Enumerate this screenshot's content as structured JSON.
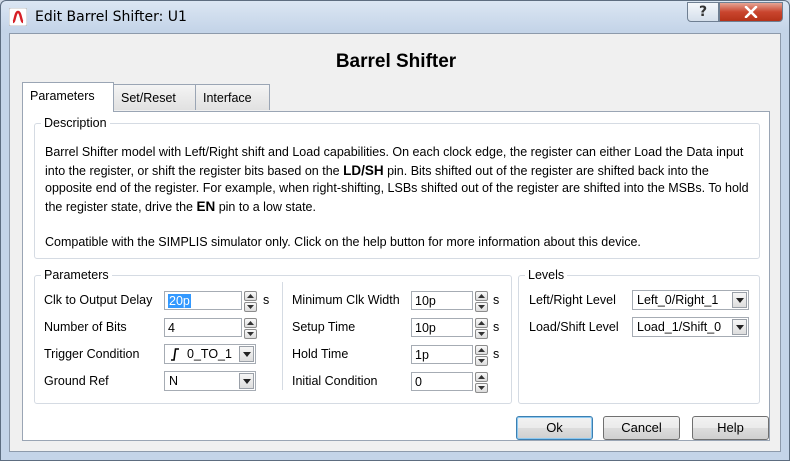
{
  "window": {
    "title": "Edit Barrel Shifter: U1",
    "help_glyph": "?",
    "close_glyph": "✕"
  },
  "heading": "Barrel Shifter",
  "tabs": [
    {
      "label": "Parameters",
      "active": true
    },
    {
      "label": "Set/Reset",
      "active": false
    },
    {
      "label": "Interface",
      "active": false
    }
  ],
  "description": {
    "legend": "Description",
    "p1_a": "Barrel Shifter model with Left/Right shift and Load capabilities. On each clock edge, the register can either Load the Data input into the register, or shift the register bits based on the ",
    "p1_pin1": "LD/SH",
    "p1_b": " pin. Bits shifted out of the register are shifted back into the opposite end of the register. For example, when right-shifting, LSBs shifted out of the register are shifted into the MSBs. To hold the register state, drive the ",
    "p1_pin2": "EN",
    "p1_c": " pin to a low state.",
    "p2": "Compatible with the SIMPLIS simulator only. Click on the help button for more information about this device."
  },
  "parameters": {
    "legend": "Parameters",
    "left": [
      {
        "label": "Clk to Output Delay",
        "value": "20p",
        "unit": "s"
      },
      {
        "label": "Number of Bits",
        "value": "4",
        "unit": ""
      },
      {
        "label": "Trigger Condition",
        "value": "0_TO_1",
        "icon": "rising-edge-icon"
      },
      {
        "label": "Ground Ref",
        "value": "N"
      }
    ],
    "right": [
      {
        "label": "Minimum Clk Width",
        "value": "10p",
        "unit": "s"
      },
      {
        "label": "Setup Time",
        "value": "10p",
        "unit": "s"
      },
      {
        "label": "Hold Time",
        "value": "1p",
        "unit": "s"
      },
      {
        "label": "Initial Condition",
        "value": "0",
        "unit": ""
      }
    ]
  },
  "levels": {
    "legend": "Levels",
    "items": [
      {
        "label": "Left/Right Level",
        "value": "Left_0/Right_1"
      },
      {
        "label": "Load/Shift Level",
        "value": "Load_1/Shift_0"
      }
    ]
  },
  "buttons": {
    "ok": "Ok",
    "cancel": "Cancel",
    "help": "Help"
  },
  "colors": {
    "selection": "#3399ff",
    "close_button": "#c9452e",
    "app_icon": "#d61f26"
  }
}
